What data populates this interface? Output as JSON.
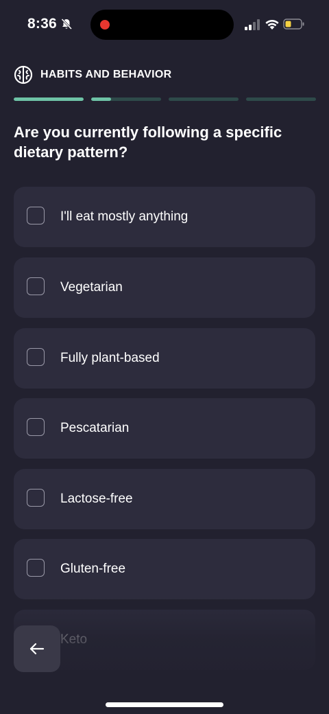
{
  "status_bar": {
    "time": "8:36",
    "icons": [
      "bell-slash-icon",
      "signal-icon",
      "wifi-icon",
      "battery-icon"
    ],
    "recording_color": "#e8372f",
    "battery_color": "#f5d142"
  },
  "header": {
    "icon": "brain-icon",
    "title": "HABITS AND BEHAVIOR",
    "progress_segments": [
      1.0,
      0.28,
      0.0,
      0.0
    ],
    "progress_color": "#6ec3a6"
  },
  "question": "Are you currently following a specific dietary pattern?",
  "options": [
    {
      "label": "I'll eat mostly anything",
      "checked": false
    },
    {
      "label": "Vegetarian",
      "checked": false
    },
    {
      "label": "Fully plant-based",
      "checked": false
    },
    {
      "label": "Pescatarian",
      "checked": false
    },
    {
      "label": "Lactose-free",
      "checked": false
    },
    {
      "label": "Gluten-free",
      "checked": false
    },
    {
      "label": "Keto",
      "checked": false
    }
  ],
  "navigation": {
    "back_icon": "arrow-left-icon"
  },
  "colors": {
    "background": "#22212f",
    "card": "#2d2c3d",
    "accent": "#6ec3a6"
  }
}
